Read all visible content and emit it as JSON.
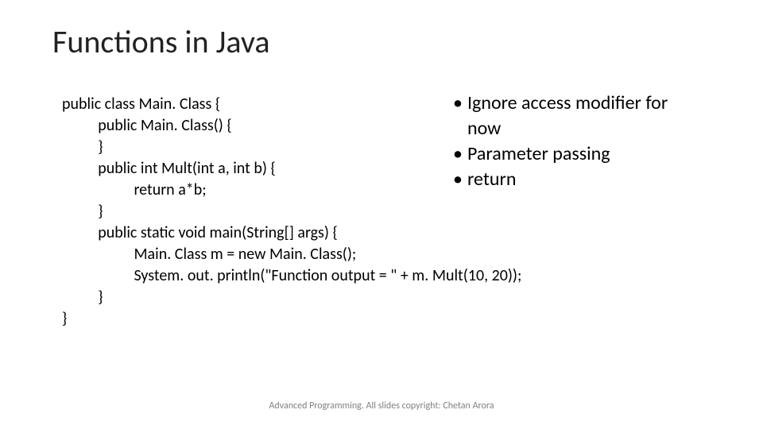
{
  "slide": {
    "title": "Functions in Java",
    "code": {
      "l1": "public class Main. Class {",
      "l2": "public Main. Class() {",
      "l3": "}",
      "l4": "public int Mult(int a, int b) {",
      "l5": "return a*b;",
      "l6": "}",
      "l7": "public static void main(String[] args) {",
      "l8": "Main. Class m = new Main. Class();",
      "l9": "System. out. println(\"Function output = \" + m. Mult(10, 20));",
      "l10": "}",
      "l11": "}"
    },
    "bullets": {
      "b1a": "Ignore access modifier for",
      "b1b": "now",
      "b2": "Parameter passing",
      "b3": "return"
    },
    "footer": "Advanced Programming. All slides copyright: Chetan Arora"
  }
}
